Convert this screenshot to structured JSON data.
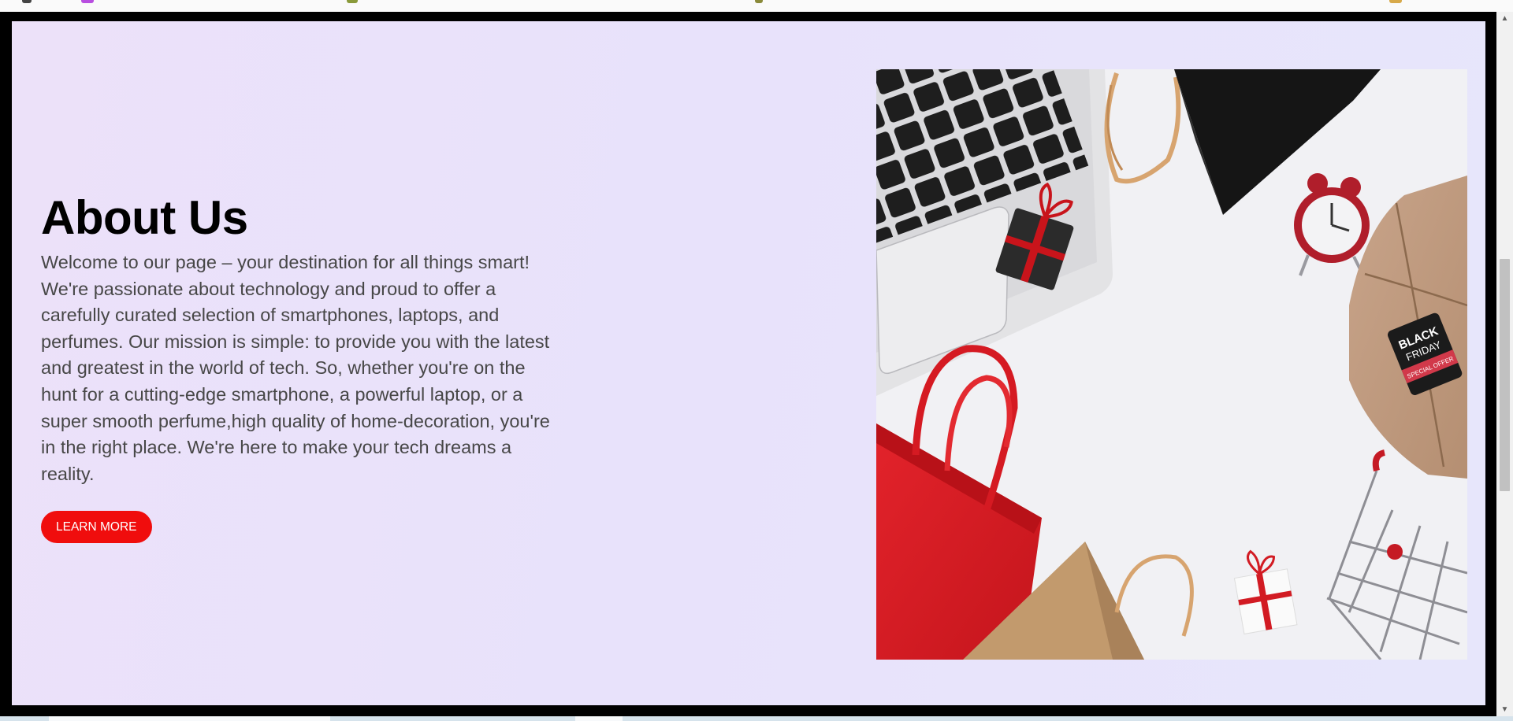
{
  "page": {
    "title": "About Us",
    "description": "Welcome to our page – your destination for all things smart! We're passionate about technology and proud to offer a carefully curated selection of smartphones, laptops, and perfumes. Our mission is simple: to provide you with the latest and greatest in the world of tech. So, whether you're on the hunt for a cutting-edge smartphone, a powerful laptop, or a super smooth perfume,high quality of home-decoration, you're in the right place. We're here to make your tech dreams a reality.",
    "button_label": "LEARN MORE"
  },
  "photo": {
    "tag_line_1": "BLACK",
    "tag_line_2": "FRIDAY",
    "tag_line_3": "SPECIAL OFFER"
  },
  "colors": {
    "accent": "#f00d0d",
    "frame": "#000000",
    "section_bg": "#e9e3fa"
  },
  "icons": [
    "scroll-up-icon",
    "scroll-down-icon"
  ]
}
